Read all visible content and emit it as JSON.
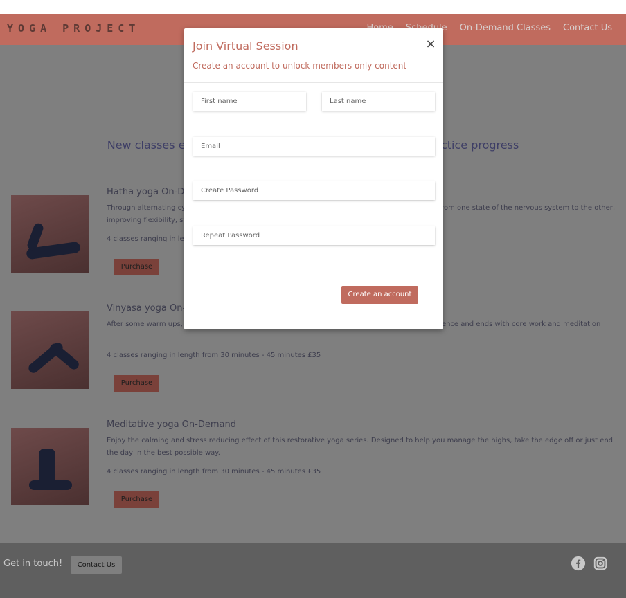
{
  "nav": {
    "brand": "YOGA PROJECT",
    "links": [
      "Home",
      "Schedule",
      "On-Demand Classes",
      "Contact Us"
    ]
  },
  "headline": "New classes every week to help you continue your yoga practice progress",
  "courses": [
    {
      "title": "Hatha yoga On-Demand",
      "description": "Through alternating cycles of movement and stillness this class trains our bodies to easily shift from one state of the nervous system to the other, improving flexibility, strength and overall health",
      "meta": "4 classes ranging in length from 30 minutes - 45 minutes £35",
      "button": "Purchase"
    },
    {
      "title": "Vinyasa yoga On-Demand",
      "description": "After some warm ups, this class builds up to a strong, flowing, dynamic and potent vinyasa sequence and ends with core work and meditation",
      "meta": "4 classes ranging in length from 30 minutes - 45 minutes £35",
      "button": "Purchase"
    },
    {
      "title": "Meditative yoga On-Demand",
      "description": "Enjoy the calming and stress reducing effect of this restorative yoga series. Designed to help you manage the highs, take the edge off or just end the day in the best possible way.",
      "meta": "4 classes ranging in length from 30 minutes - 45 minutes £35",
      "button": "Purchase"
    }
  ],
  "footer": {
    "text": "Get in touch!",
    "button": "Contact Us",
    "icons": [
      "facebook-icon",
      "instagram-icon"
    ]
  },
  "modal": {
    "title": "Join Virtual Session",
    "subtitle": "Create an account to unlock members only content",
    "close": "×",
    "fields": {
      "first_name": "First name",
      "last_name": "Last name",
      "email": "Email",
      "password": "Create Password",
      "repeat_password": "Repeat Password"
    },
    "submit": "Create an account"
  },
  "colors": {
    "accent": "#c06b5e",
    "overlay_page": "#7f7f7f",
    "footer": "#5f5f5f"
  }
}
